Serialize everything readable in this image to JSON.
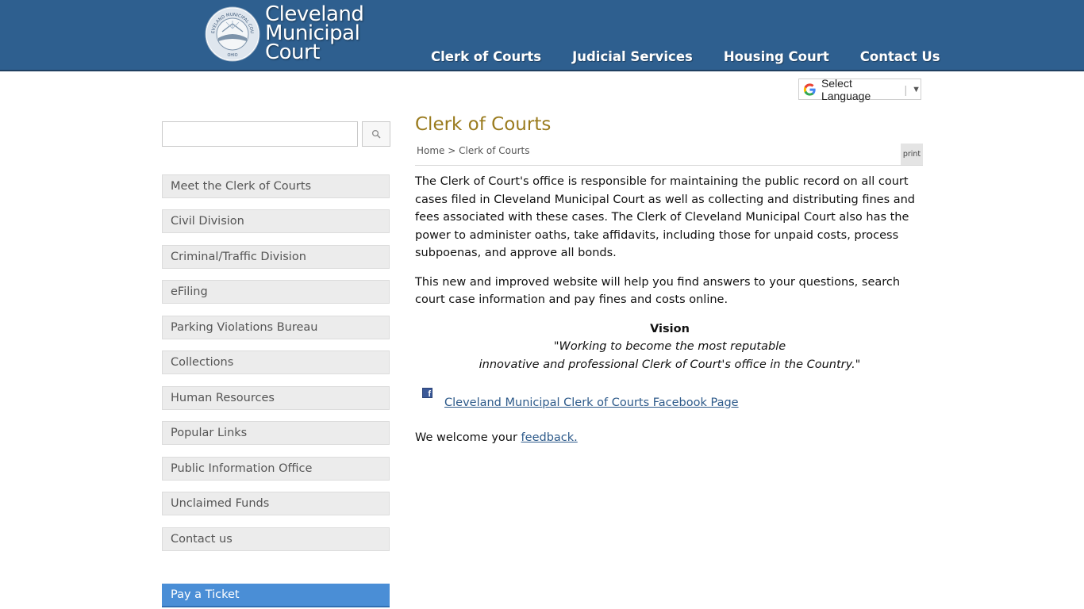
{
  "header": {
    "logo_lines": [
      "Cleveland",
      "Municipal",
      "Court"
    ],
    "seal_text": "CLEVELAND MUNICIPAL COURT",
    "seal_bottom": "OHIO",
    "nav": [
      "Clerk of Courts",
      "Judicial Services",
      "Housing Court",
      "Contact Us"
    ]
  },
  "translate": {
    "label": "Select Language",
    "arrow": "▼"
  },
  "search": {
    "placeholder": "",
    "button_icon": "search-icon"
  },
  "sidebar": {
    "items": [
      "Meet the Clerk of Courts",
      "Civil Division",
      "Criminal/Traffic Division",
      "eFiling",
      "Parking Violations Bureau",
      "Collections",
      "Human Resources",
      "Popular Links",
      "Public Information Office",
      "Unclaimed Funds",
      "Contact us"
    ],
    "pay_ticket": "Pay a Ticket"
  },
  "main": {
    "title": "Clerk of Courts",
    "breadcrumb": {
      "home": "Home",
      "sep": " > ",
      "current": "Clerk of Courts"
    },
    "print_label": "print",
    "paragraphs": [
      "The Clerk of Court's office is responsible for maintaining the public record on all court cases filed in Cleveland Municipal Court as well as collecting and distributing fines and fees associated with these cases. The Clerk of Cleveland Municipal Court also has the power to administer oaths, take affidavits, including those for unpaid costs, process subpoenas, and approve all bonds.",
      "This new and improved website will help you find answers to your questions, search court case information and pay fines and costs online."
    ],
    "vision": {
      "title": "Vision",
      "line1": "\"Working to become the most reputable",
      "line2": "innovative and professional Clerk of Court's office in the Country.\""
    },
    "facebook_link": "Cleveland Municipal Clerk of Courts Facebook Page",
    "welcome_text": "We welcome your ",
    "feedback_link": "feedback."
  },
  "colors": {
    "header_bg": "#2e5f8f",
    "title_gold": "#9a7b1e",
    "pay_ticket_bg": "#4a8ed6",
    "link": "#2d5a8a"
  }
}
